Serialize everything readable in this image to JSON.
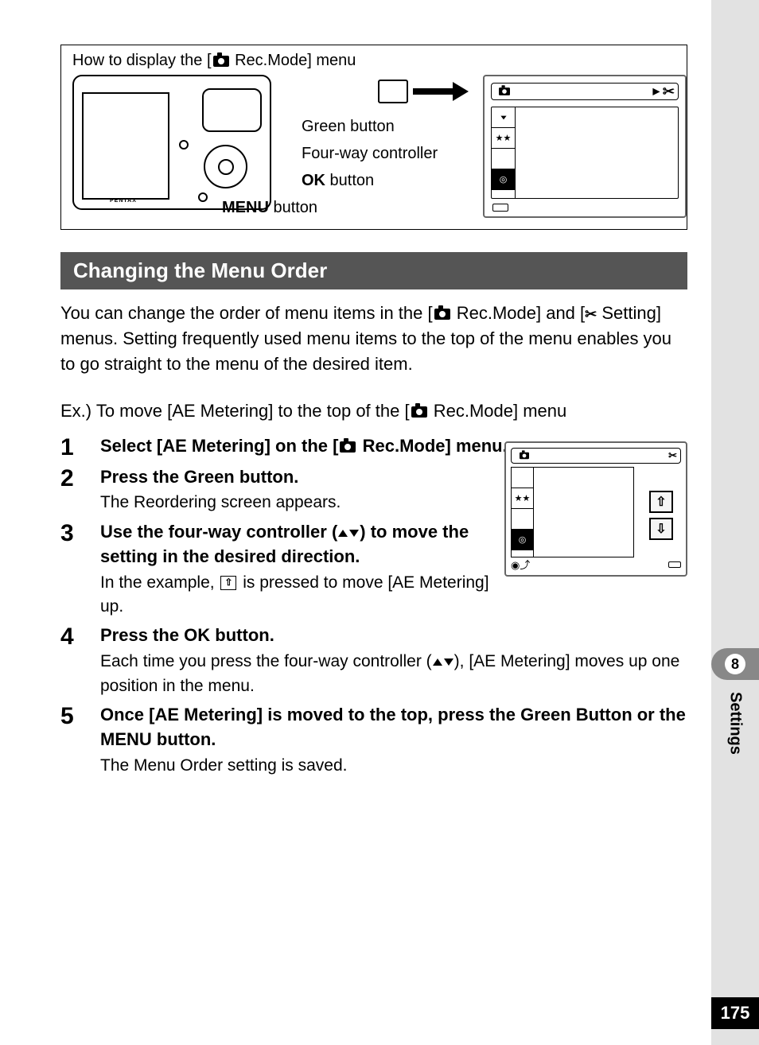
{
  "page_number": "175",
  "chapter_number": "8",
  "section_label": "Settings",
  "howto": {
    "title_prefix": "How to display the [",
    "title_suffix": " Rec.Mode] menu",
    "labels": {
      "green": "Green button",
      "fourway": "Four-way controller",
      "ok_prefix": "OK",
      "ok_suffix": " button",
      "menu_prefix": "MENU",
      "menu_suffix": " button"
    },
    "brand": "PENTAX"
  },
  "heading": "Changing the Menu Order",
  "intro_prefix": "You can change the order of menu items in the [",
  "intro_mid": " Rec.Mode] and [",
  "intro_suffix": " Setting] menus. Setting frequently used menu items to the top of the menu enables you to go straight to the menu of the desired item.",
  "example_prefix": "Ex.) To move [AE Metering] to the top of the [",
  "example_suffix": " Rec.Mode] menu",
  "steps": [
    {
      "num": "1",
      "head_prefix": "Select [AE Metering] on the [",
      "head_suffix": " Rec.Mode] menu."
    },
    {
      "num": "2",
      "head": "Press the Green button.",
      "sub": "The Reordering screen appears."
    },
    {
      "num": "3",
      "head_prefix": "Use the four-way controller (",
      "head_suffix": ") to move the setting in the desired direction.",
      "sub_prefix": "In the example, ",
      "sub_suffix": " is pressed to move [AE Metering] up."
    },
    {
      "num": "4",
      "head_prefix": "Press the ",
      "head_ok": "OK",
      "head_suffix": " button.",
      "sub_prefix": "Each time you press the four-way controller (",
      "sub_suffix": "), [AE Metering] moves up one position in the menu."
    },
    {
      "num": "5",
      "head_prefix": "Once [AE Metering] is moved to the top, press the Green Button or the ",
      "head_menu": "MENU",
      "head_suffix": " button.",
      "sub": "The Menu Order setting is saved."
    }
  ]
}
